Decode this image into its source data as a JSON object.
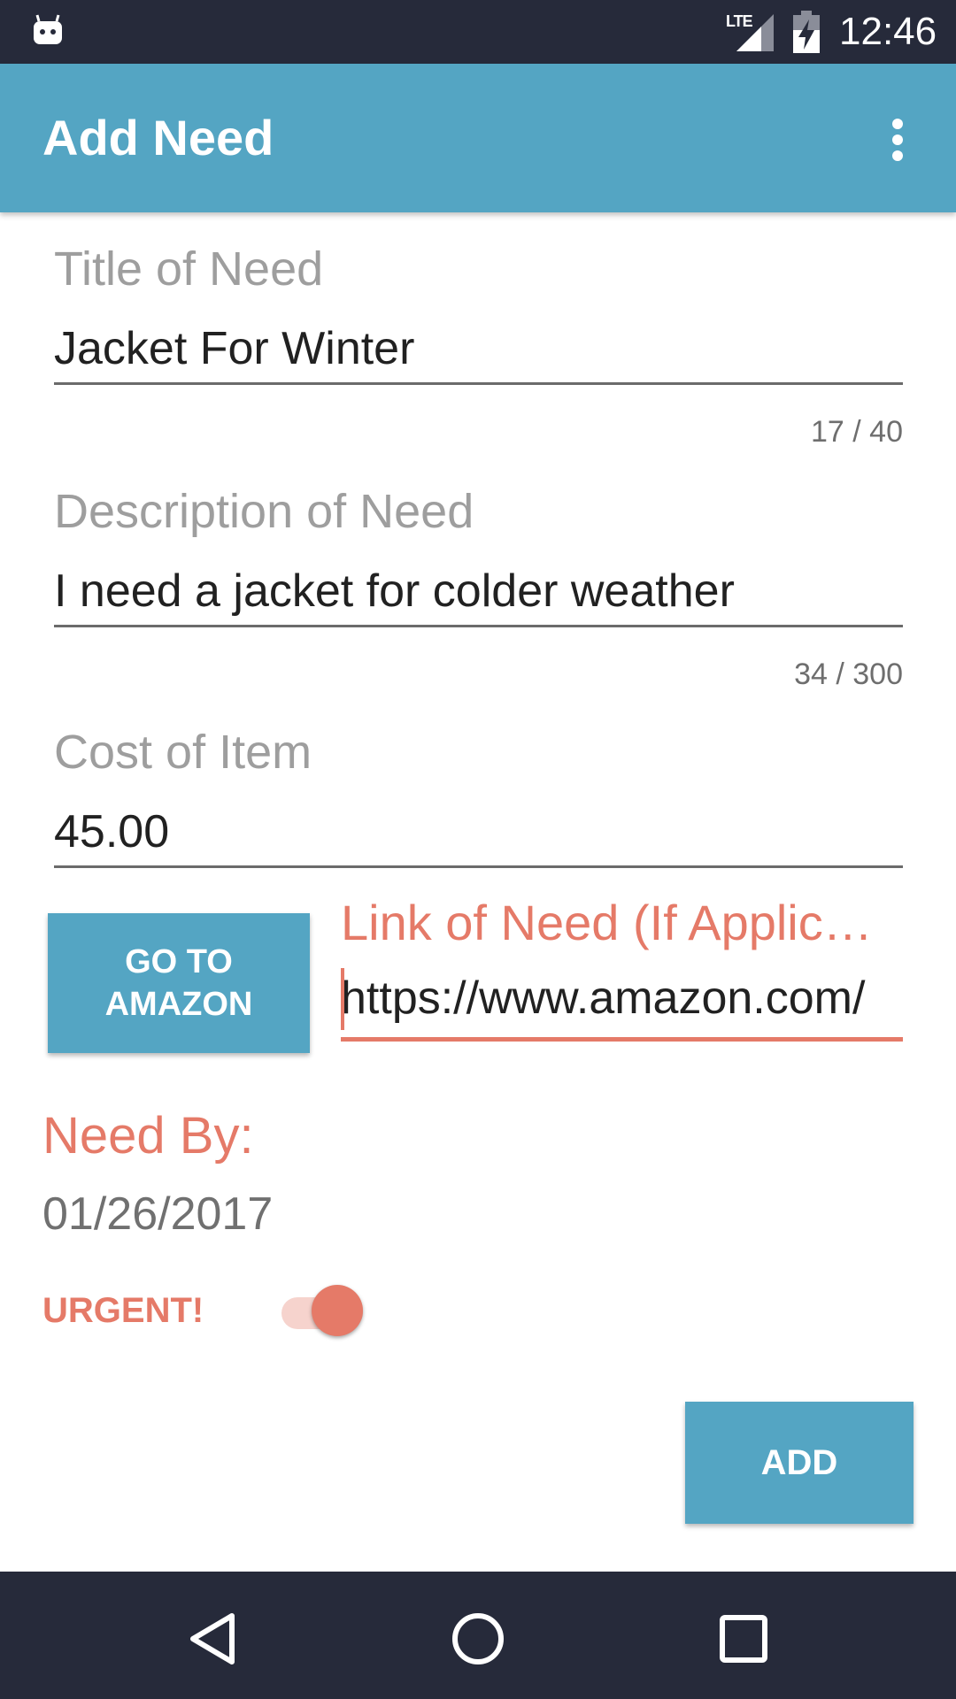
{
  "status_bar": {
    "network": "LTE",
    "time": "12:46"
  },
  "app_bar": {
    "title": "Add Need",
    "menu_icon": "overflow-menu-icon"
  },
  "form": {
    "title_field": {
      "label": "Title of Need",
      "value": "Jacket For Winter",
      "counter": "17 / 40"
    },
    "description_field": {
      "label": "Description of Need",
      "value": "I need a jacket for colder weather",
      "counter": "34 / 300"
    },
    "cost_field": {
      "label": "Cost of Item",
      "value": "45.00"
    },
    "amazon_button": {
      "label": "GO TO AMAZON"
    },
    "link_field": {
      "label": "Link of Need (If Applic…",
      "value": "https://www.amazon.com/"
    },
    "need_by": {
      "label": "Need By:",
      "date": "01/26/2017"
    },
    "urgent": {
      "label": "URGENT!",
      "on": true
    },
    "add_button": {
      "label": "ADD"
    }
  },
  "colors": {
    "primary": "#54a5c3",
    "accent": "#e57a68",
    "status_bar": "#262a3a"
  },
  "nav_bar": {
    "icons": [
      "back-icon",
      "home-icon",
      "recents-icon"
    ]
  }
}
